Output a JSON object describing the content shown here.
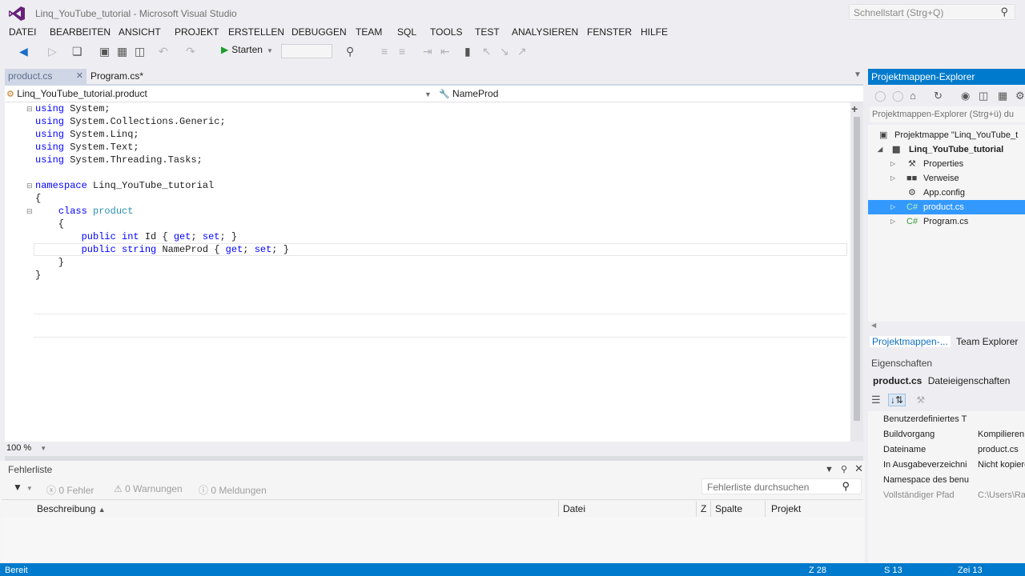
{
  "window": {
    "title": "Linq_YouTube_tutorial - Microsoft Visual Studio"
  },
  "quick_launch": {
    "placeholder": "Schnellstart (Strg+Q)"
  },
  "menu": [
    "DATEI",
    "BEARBEITEN",
    "ANSICHT",
    "PROJEKT",
    "ERSTELLEN",
    "DEBUGGEN",
    "TEAM",
    "SQL",
    "TOOLS",
    "TEST",
    "ANALYSIEREN",
    "FENSTER",
    "HILFE"
  ],
  "toolbar": {
    "start_label": "Starten"
  },
  "tabs": [
    {
      "label": "product.cs",
      "active": true
    },
    {
      "label": "Program.cs*",
      "active": false
    }
  ],
  "navbar": {
    "type": "Linq_YouTube_tutorial.product",
    "member": "NameProd"
  },
  "code": {
    "lines": [
      [
        {
          "t": "using",
          "c": "kw"
        },
        {
          "t": " System;"
        }
      ],
      [
        {
          "t": "using",
          "c": "kw"
        },
        {
          "t": " System.Collections.Generic;"
        }
      ],
      [
        {
          "t": "using",
          "c": "kw"
        },
        {
          "t": " System.Linq;"
        }
      ],
      [
        {
          "t": "using",
          "c": "kw"
        },
        {
          "t": " System.Text;"
        }
      ],
      [
        {
          "t": "using",
          "c": "kw"
        },
        {
          "t": " System.Threading.Tasks;"
        }
      ],
      [],
      [
        {
          "t": "namespace",
          "c": "kw"
        },
        {
          "t": " Linq_YouTube_tutorial"
        }
      ],
      [
        {
          "t": "{"
        }
      ],
      [
        {
          "t": "    "
        },
        {
          "t": "class",
          "c": "kw"
        },
        {
          "t": " "
        },
        {
          "t": "product",
          "c": "ty"
        }
      ],
      [
        {
          "t": "    {"
        }
      ],
      [
        {
          "t": "        "
        },
        {
          "t": "public",
          "c": "kw"
        },
        {
          "t": " "
        },
        {
          "t": "int",
          "c": "kw"
        },
        {
          "t": " Id { "
        },
        {
          "t": "get",
          "c": "kw"
        },
        {
          "t": "; "
        },
        {
          "t": "set",
          "c": "kw"
        },
        {
          "t": "; }"
        }
      ],
      [
        {
          "t": "        "
        },
        {
          "t": "public",
          "c": "kw"
        },
        {
          "t": " "
        },
        {
          "t": "string",
          "c": "kw"
        },
        {
          "t": " NameProd { "
        },
        {
          "t": "get",
          "c": "kw"
        },
        {
          "t": "; "
        },
        {
          "t": "set",
          "c": "kw"
        },
        {
          "t": "; }"
        }
      ],
      [
        {
          "t": "    }"
        }
      ],
      [
        {
          "t": "}"
        }
      ]
    ]
  },
  "editor": {
    "zoom": "100 %"
  },
  "error_list": {
    "title": "Fehlerliste",
    "errors": "0 Fehler",
    "warnings": "0 Warnungen",
    "messages": "0 Meldungen",
    "search_placeholder": "Fehlerliste durchsuchen",
    "columns": [
      "Beschreibung",
      "Datei",
      "Z",
      "Spalte",
      "Projekt"
    ]
  },
  "solution_explorer": {
    "title": "Projektmappen-Explorer",
    "search_placeholder": "Projektmappen-Explorer (Strg+ü) du",
    "solution": "Projektmappe \"Linq_YouTube_t",
    "project": "Linq_YouTube_tutorial",
    "items": [
      {
        "label": "Properties",
        "icon": "wrench-icon"
      },
      {
        "label": "Verweise",
        "icon": "references-icon"
      },
      {
        "label": "App.config",
        "icon": "config-file-icon"
      },
      {
        "label": "product.cs",
        "icon": "csharp-file-icon",
        "selected": true
      },
      {
        "label": "Program.cs",
        "icon": "csharp-file-icon"
      }
    ],
    "tabs": [
      "Projektmappen-...",
      "Team Explorer"
    ]
  },
  "properties": {
    "title": "Eigenschaften",
    "object_name": "product.cs",
    "object_type": "Dateieigenschaften",
    "rows": [
      {
        "key": "Benutzerdefiniertes T",
        "value": ""
      },
      {
        "key": "Buildvorgang",
        "value": "Kompilieren"
      },
      {
        "key": "Dateiname",
        "value": "product.cs"
      },
      {
        "key": "In Ausgabeverzeichni",
        "value": "Nicht kopieren"
      },
      {
        "key": "Namespace des benu",
        "value": ""
      },
      {
        "key": "Vollständiger Pfad",
        "value": "C:\\Users\\Ra",
        "grey": true
      }
    ]
  },
  "status": {
    "left": "Bereit",
    "line": "Z 28",
    "col": "S 13",
    "ch": "Zei 13"
  },
  "colors": {
    "accent": "#007acc",
    "keyword": "#0000ff",
    "type": "#2b91af",
    "selection": "#3399ff"
  }
}
